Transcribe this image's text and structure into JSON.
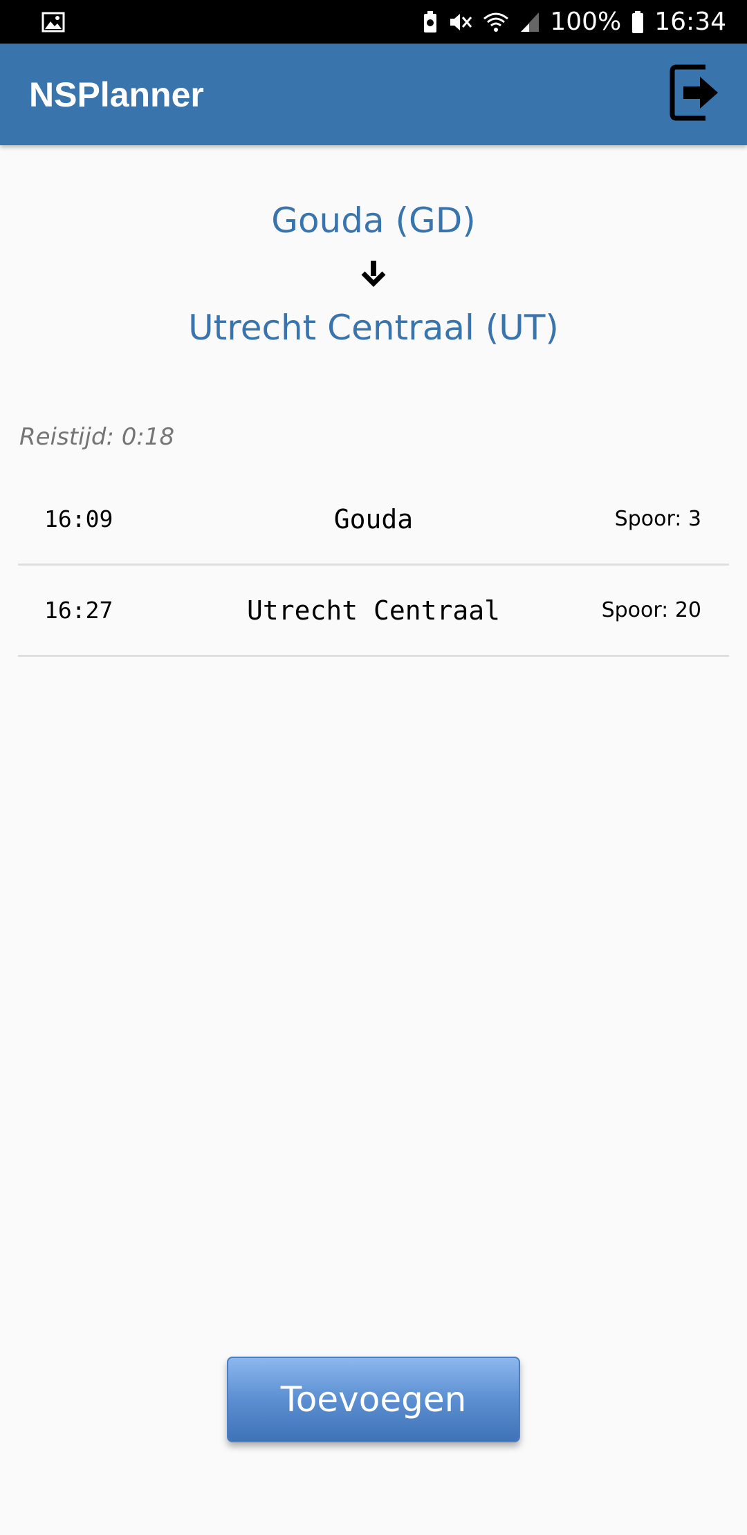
{
  "status_bar": {
    "left_icon": "image-icon",
    "battery_saver_icon": "battery-saver-icon",
    "mute_icon": "vibrate-off-icon",
    "wifi_icon": "wifi-icon",
    "signal_icon": "signal-icon",
    "battery_percent": "100%",
    "battery_icon": "battery-icon",
    "time": "16:34"
  },
  "app_bar": {
    "title": "NSPlanner",
    "logout_icon": "logout-icon",
    "color": "#3a74ad"
  },
  "route": {
    "from": "Gouda (GD)",
    "to": "Utrecht Centraal (UT)",
    "arrow_icon": "arrow-down-icon"
  },
  "travel_time": "Reistijd: 0:18",
  "stops": [
    {
      "time": "16:09",
      "station": "Gouda",
      "platform": "Spoor: 3"
    },
    {
      "time": "16:27",
      "station": "Utrecht Centraal",
      "platform": "Spoor: 20"
    }
  ],
  "actions": {
    "add_label": "Toevoegen"
  }
}
